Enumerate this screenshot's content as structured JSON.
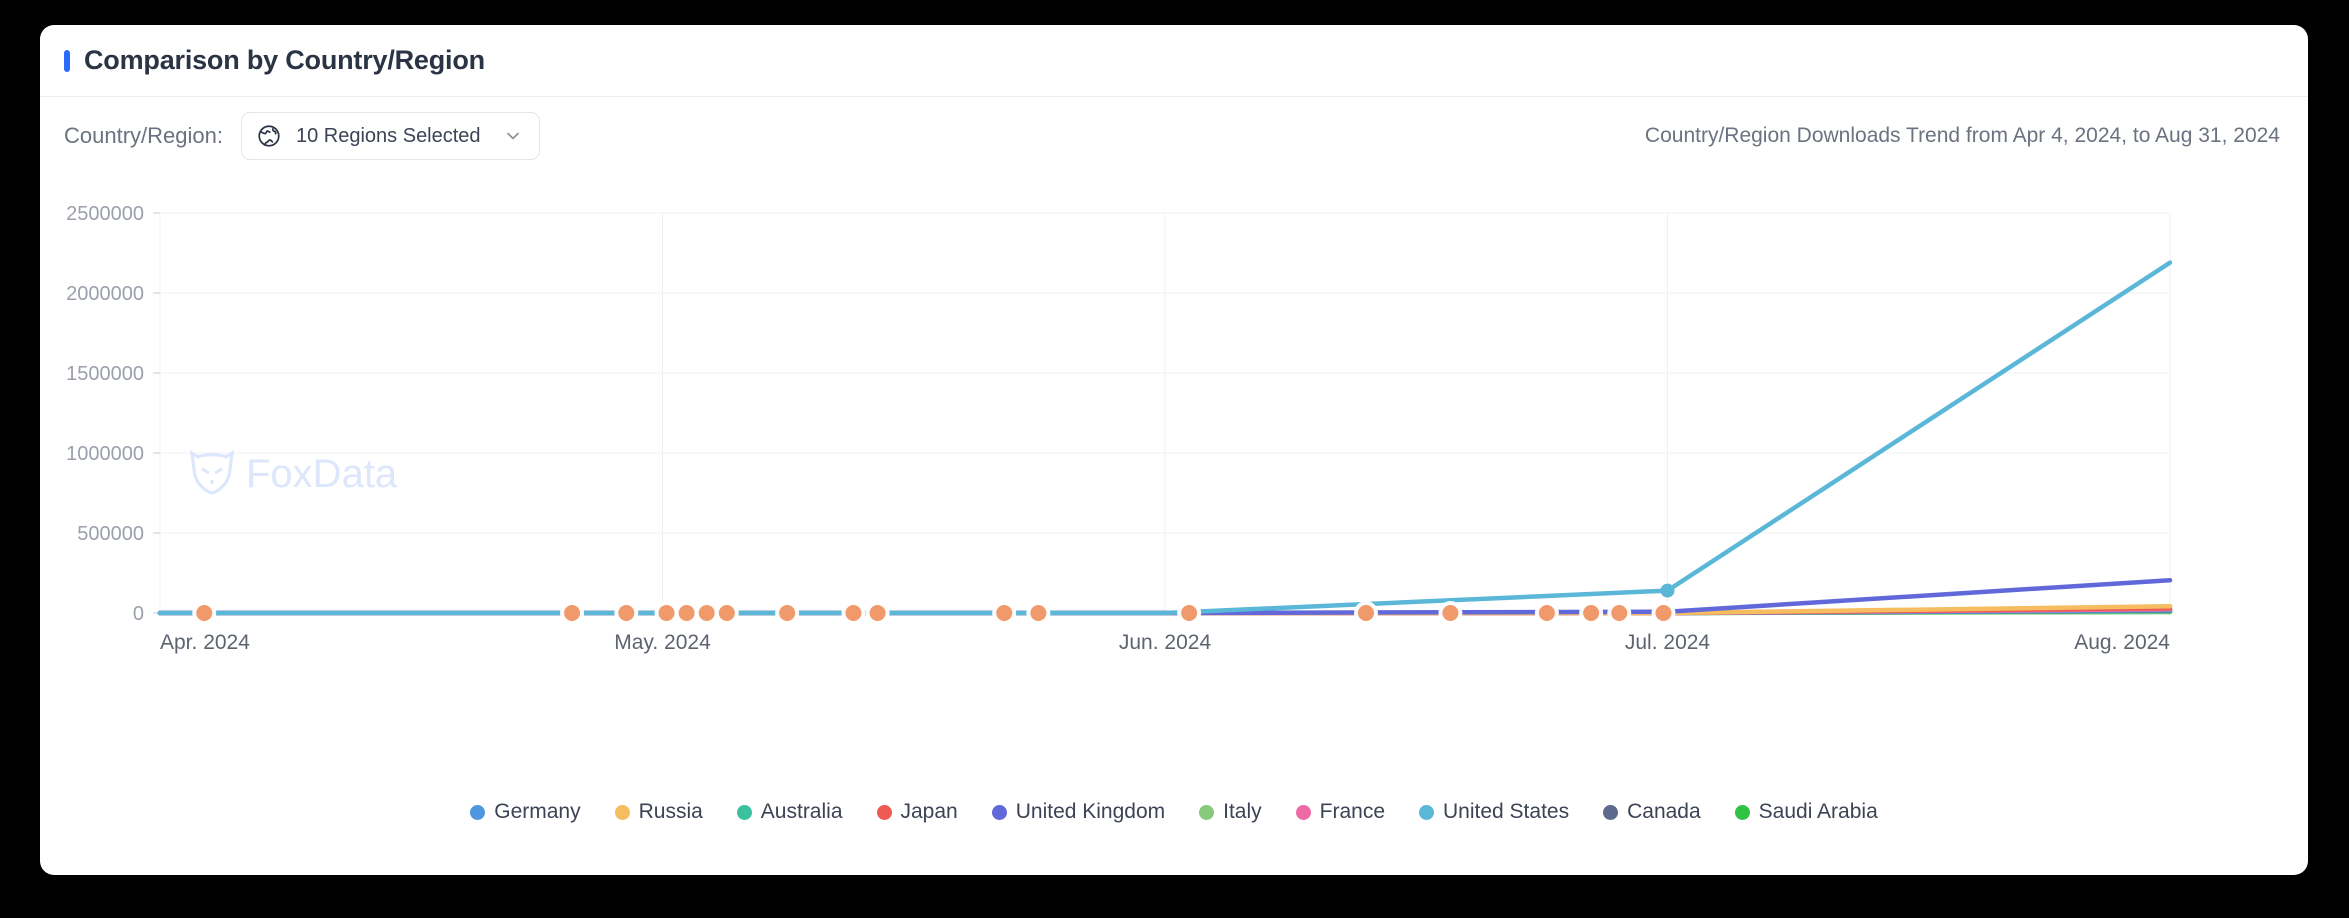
{
  "header": {
    "title": "Comparison by Country/Region",
    "accent_color": "#2a6bfb"
  },
  "filter": {
    "label": "Country/Region:",
    "globe_icon": "globe-icon",
    "selected_value": "10 Regions Selected",
    "chevron_icon": "chevron-down-icon"
  },
  "trend_caption": "Country/Region Downloads Trend from Apr 4, 2024, to Aug 31, 2024",
  "watermark": {
    "text": "FoxData",
    "color": "#dde7fb"
  },
  "legend": [
    {
      "label": "Germany",
      "color": "#4e97e0"
    },
    {
      "label": "Russia",
      "color": "#f6bd60"
    },
    {
      "label": "Australia",
      "color": "#3bc1a0"
    },
    {
      "label": "Japan",
      "color": "#ef5b52"
    },
    {
      "label": "United Kingdom",
      "color": "#6168d9"
    },
    {
      "label": "Italy",
      "color": "#88c97c"
    },
    {
      "label": "France",
      "color": "#ee6aa7"
    },
    {
      "label": "United States",
      "color": "#5bb7d8"
    },
    {
      "label": "Canada",
      "color": "#5d6a8b"
    },
    {
      "label": "Saudi Arabia",
      "color": "#2fc244"
    }
  ],
  "chart_data": {
    "type": "line",
    "title": "Country/Region Downloads Trend from Apr 4, 2024, to Aug 31, 2024",
    "xlabel": "",
    "ylabel": "",
    "grid": true,
    "legend_position": "bottom",
    "x_tick_labels": [
      "Apr. 2024",
      "May. 2024",
      "Jun. 2024",
      "Jul. 2024",
      "Aug. 2024"
    ],
    "x_tick_positions": [
      0,
      0.25,
      0.5,
      0.75,
      1.0
    ],
    "y_tick_labels": [
      "0",
      "500000",
      "1000000",
      "1500000",
      "2000000",
      "2500000"
    ],
    "y_ticks": [
      0,
      500000,
      1000000,
      1500000,
      2000000,
      2500000
    ],
    "ylim": [
      0,
      2500000
    ],
    "x_range": [
      "Apr 4, 2024",
      "Aug 31, 2024"
    ],
    "series": [
      {
        "name": "Germany",
        "color": "#4e97e0",
        "x": [
          0.0,
          0.25,
          0.5,
          0.75,
          1.0
        ],
        "values": [
          0,
          0,
          0,
          0,
          18000
        ]
      },
      {
        "name": "Russia",
        "color": "#f6bd60",
        "x": [
          0.0,
          0.25,
          0.5,
          0.75,
          1.0
        ],
        "values": [
          0,
          0,
          0,
          0,
          42000
        ]
      },
      {
        "name": "Australia",
        "color": "#3bc1a0",
        "x": [
          0.0,
          0.25,
          0.5,
          0.75,
          1.0
        ],
        "values": [
          0,
          0,
          0,
          0,
          12000
        ]
      },
      {
        "name": "Japan",
        "color": "#ef5b52",
        "x": [
          0.0,
          0.25,
          0.5,
          0.75,
          1.0
        ],
        "values": [
          0,
          0,
          0,
          0,
          30000
        ]
      },
      {
        "name": "United Kingdom",
        "color": "#6168d9",
        "x": [
          0.0,
          0.25,
          0.5,
          0.75,
          1.0
        ],
        "values": [
          0,
          0,
          0,
          8000,
          205000
        ]
      },
      {
        "name": "Italy",
        "color": "#88c97c",
        "x": [
          0.0,
          0.25,
          0.5,
          0.75,
          1.0
        ],
        "values": [
          0,
          0,
          0,
          0,
          9000
        ]
      },
      {
        "name": "France",
        "color": "#ee6aa7",
        "x": [
          0.0,
          0.25,
          0.5,
          0.75,
          1.0
        ],
        "values": [
          0,
          0,
          0,
          0,
          24000
        ]
      },
      {
        "name": "United States",
        "color": "#5bb7d8",
        "x": [
          0.0,
          0.25,
          0.5,
          0.75,
          1.0
        ],
        "values": [
          0,
          0,
          0,
          140000,
          2190000
        ]
      },
      {
        "name": "Canada",
        "color": "#5d6a8b",
        "x": [
          0.0,
          0.25,
          0.5,
          0.75,
          1.0
        ],
        "values": [
          0,
          0,
          0,
          0,
          15000
        ]
      },
      {
        "name": "Saudi Arabia",
        "color": "#2fc244",
        "x": [
          0.0,
          0.25,
          0.5,
          0.75,
          1.0
        ],
        "values": [
          0,
          0,
          0,
          0,
          6000
        ]
      }
    ],
    "markers": {
      "color": "#f0996a",
      "note": "Russia data-point markers along the baseline",
      "x_fractions": [
        0.022,
        0.205,
        0.232,
        0.252,
        0.262,
        0.272,
        0.282,
        0.312,
        0.345,
        0.357,
        0.42,
        0.437,
        0.512,
        0.6,
        0.642,
        0.69,
        0.712,
        0.726,
        0.748
      ]
    }
  }
}
